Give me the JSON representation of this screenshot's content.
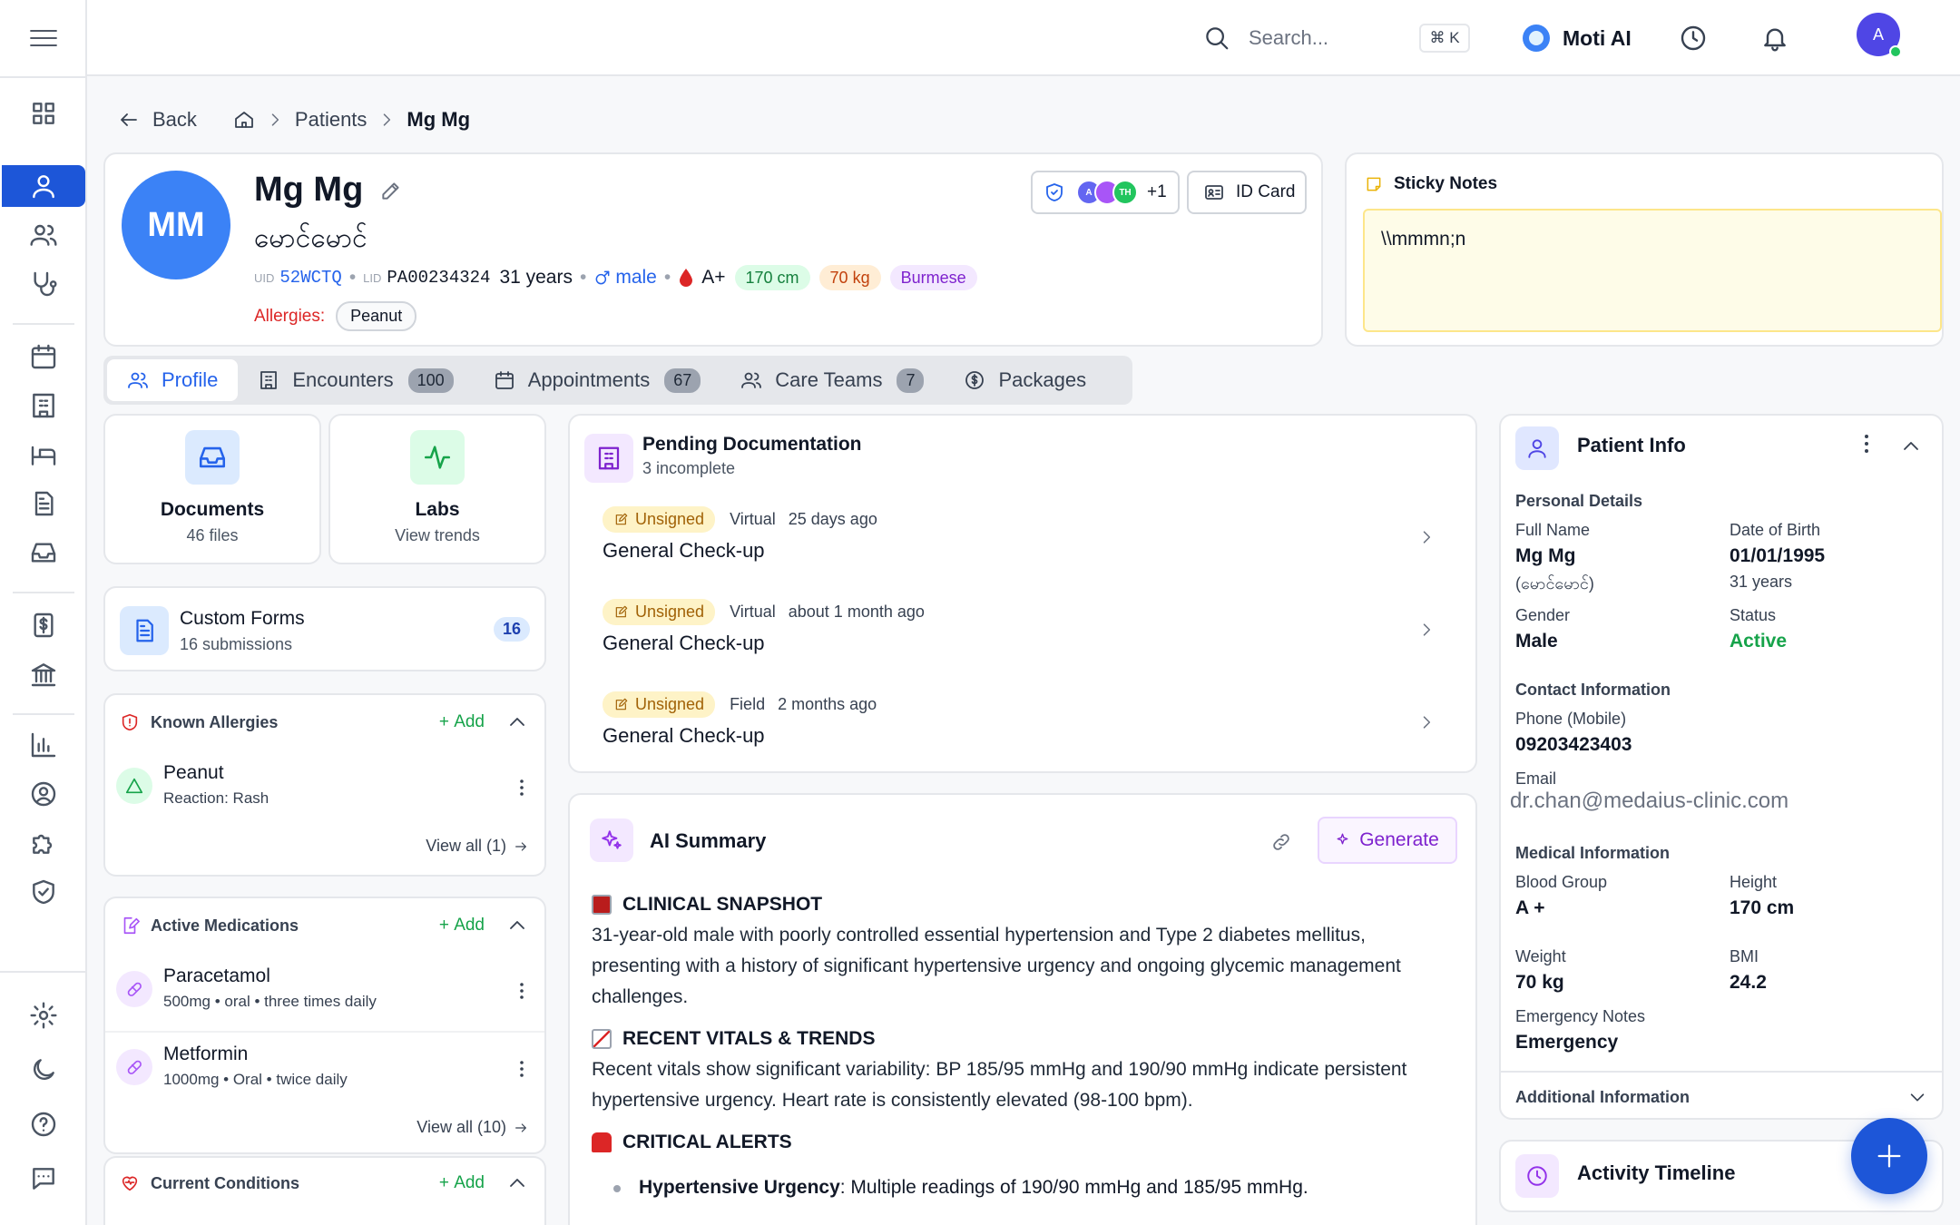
{
  "topbar": {
    "search_placeholder": "Search...",
    "search_shortcut": "⌘ K",
    "assistant_name": "Moti AI",
    "user_initial": "A"
  },
  "breadcrumb": {
    "back": "Back",
    "patients": "Patients",
    "current": "Mg Mg"
  },
  "patient": {
    "initials": "MM",
    "name": "Mg Mg",
    "name_local": "မောင်မောင်",
    "uid_label": "UID",
    "uid": "52WCTQ",
    "lid_label": "LID",
    "lid": "PA00234324",
    "age": "31 years",
    "sex": "male",
    "blood_group": "A+",
    "height": "170 cm",
    "weight": "70 kg",
    "ethnicity": "Burmese",
    "allergies_label": "Allergies:",
    "allergy_chip": "Peanut",
    "care_team_extra": "+1",
    "care_team_initials": [
      "A",
      "",
      "TH"
    ],
    "id_card_label": "ID Card"
  },
  "sticky": {
    "title": "Sticky Notes",
    "text": "\\\\mmmn;n"
  },
  "tabs": [
    {
      "label": "Profile"
    },
    {
      "label": "Encounters",
      "count": "100"
    },
    {
      "label": "Appointments",
      "count": "67"
    },
    {
      "label": "Care Teams",
      "count": "7"
    },
    {
      "label": "Packages"
    }
  ],
  "tiles": {
    "documents": {
      "title": "Documents",
      "sub": "46 files"
    },
    "labs": {
      "title": "Labs",
      "sub": "View trends"
    }
  },
  "custom_forms": {
    "title": "Custom Forms",
    "sub": "16 submissions",
    "count": "16"
  },
  "known_allergies": {
    "title": "Known Allergies",
    "add": "Add",
    "items": [
      {
        "name": "Peanut",
        "detail": "Reaction: Rash"
      }
    ],
    "view_all": "View all (1)"
  },
  "active_medications": {
    "title": "Active Medications",
    "add": "Add",
    "items": [
      {
        "name": "Paracetamol",
        "detail": "500mg • oral • three times daily"
      },
      {
        "name": "Metformin",
        "detail": "1000mg • Oral • twice daily"
      }
    ],
    "view_all": "View all (10)"
  },
  "current_conditions": {
    "title": "Current Conditions",
    "add": "Add"
  },
  "pending_docs": {
    "title": "Pending Documentation",
    "sub": "3 incomplete",
    "items": [
      {
        "status": "Unsigned",
        "kind": "Virtual",
        "when": "25 days ago",
        "title": "General Check-up"
      },
      {
        "status": "Unsigned",
        "kind": "Virtual",
        "when": "about 1 month ago",
        "title": "General Check-up"
      },
      {
        "status": "Unsigned",
        "kind": "Field",
        "when": "2 months ago",
        "title": "General Check-up"
      }
    ]
  },
  "ai_summary": {
    "title": "AI Summary",
    "generate": "Generate",
    "h1": "CLINICAL SNAPSHOT",
    "p1": "31-year-old male with poorly controlled essential hypertension and Type 2 diabetes mellitus, presenting with a history of significant hypertensive urgency and ongoing glycemic management challenges.",
    "h2": "RECENT VITALS & TRENDS",
    "p2": "Recent vitals show significant variability: BP 185/95 mmHg and 190/90 mmHg indicate persistent hypertensive urgency. Heart rate is consistently elevated (98-100 bpm).",
    "h3": "CRITICAL ALERTS",
    "bullet_bold": "Hypertensive Urgency",
    "bullet_rest": ": Multiple readings of 190/90 mmHg and 185/95 mmHg."
  },
  "patient_info": {
    "title": "Patient Info",
    "personal_details": "Personal Details",
    "full_name_label": "Full Name",
    "full_name": "Mg Mg",
    "full_name_local": "(မောင်မောင်)",
    "dob_label": "Date of Birth",
    "dob": "01/01/1995",
    "dob_age": "31 years",
    "gender_label": "Gender",
    "gender": "Male",
    "status_label": "Status",
    "status": "Active",
    "contact_info": "Contact Information",
    "phone_label": "Phone (Mobile)",
    "phone": "09203423403",
    "email_label": "Email",
    "email": "dr.chan@medaius-clinic.com",
    "medical_info": "Medical Information",
    "blood_label": "Blood Group",
    "blood": "A +",
    "height_label": "Height",
    "height": "170 cm",
    "weight_label": "Weight",
    "weight": "70 kg",
    "bmi_label": "BMI",
    "bmi": "24.2",
    "emergency_label": "Emergency Notes",
    "emergency": "Emergency",
    "additional": "Additional Information"
  },
  "timeline": {
    "title": "Activity Timeline"
  },
  "colors": {
    "primary": "#1d56d8",
    "success": "#16a34a",
    "danger": "#dc2626",
    "accent_purple": "#7e22ce"
  }
}
